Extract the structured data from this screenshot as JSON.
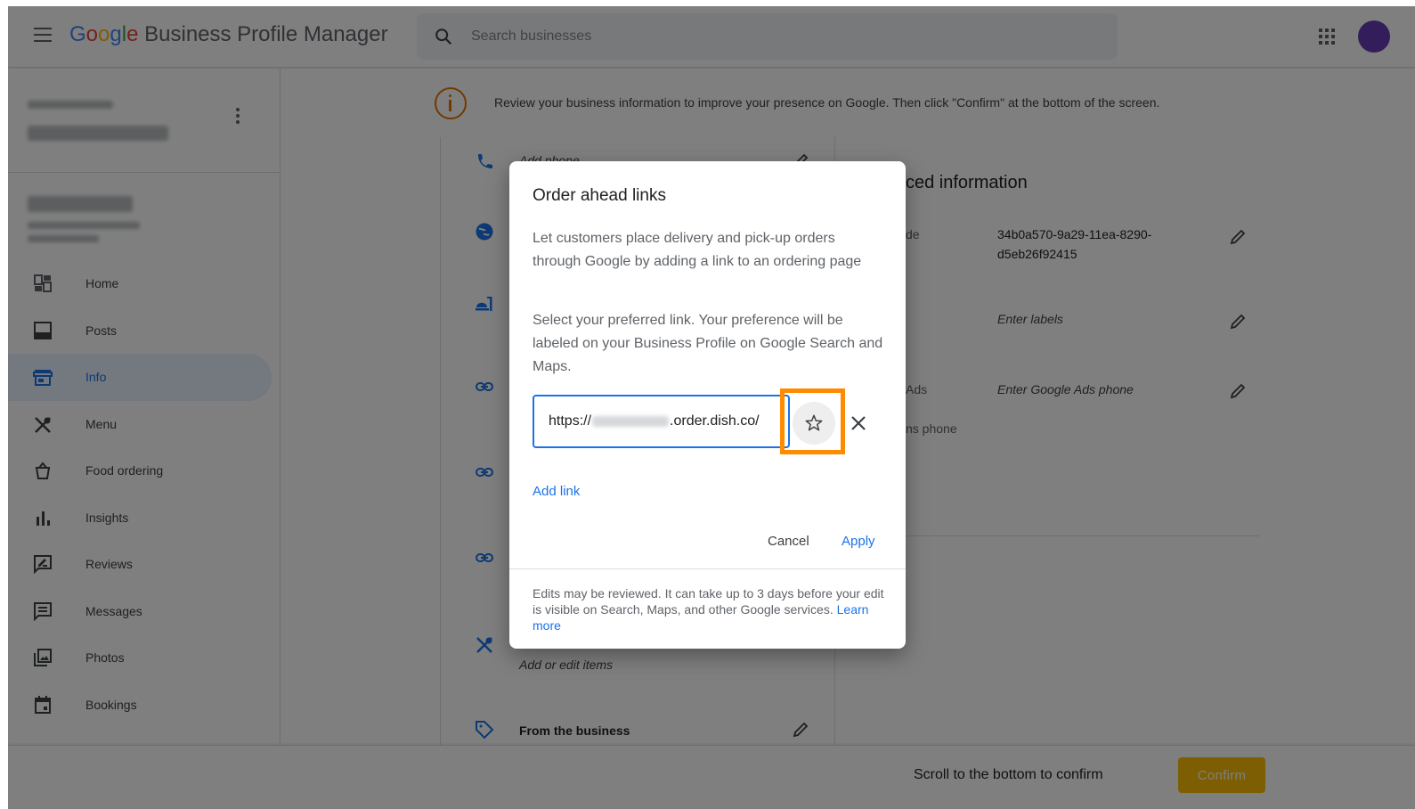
{
  "header": {
    "logo_google": [
      "G",
      "o",
      "o",
      "g",
      "l",
      "e"
    ],
    "logo_rest": "Business Profile Manager",
    "search_placeholder": "Search businesses"
  },
  "sidebar": {
    "items": [
      {
        "label": "Home",
        "icon": "dashboard-icon"
      },
      {
        "label": "Posts",
        "icon": "posts-icon"
      },
      {
        "label": "Info",
        "icon": "storefront-icon"
      },
      {
        "label": "Menu",
        "icon": "restaurant-icon"
      },
      {
        "label": "Food ordering",
        "icon": "takeout-icon"
      },
      {
        "label": "Insights",
        "icon": "bar-chart-icon"
      },
      {
        "label": "Reviews",
        "icon": "reviews-icon"
      },
      {
        "label": "Messages",
        "icon": "messages-icon"
      },
      {
        "label": "Photos",
        "icon": "photos-icon"
      },
      {
        "label": "Bookings",
        "icon": "calendar-icon"
      }
    ],
    "active_index": 2
  },
  "main": {
    "notice": "Review your business information to improve your presence on Google. Then click \"Confirm\" at the bottom of the screen.",
    "rows": {
      "phone": "Add phone",
      "menu": "Add or edit items",
      "from_business": "From the business"
    },
    "advanced": {
      "title_fragment": "ced information",
      "store_code_label": "de",
      "store_code_value": "34b0a570-9a29-11ea-8290-d5eb26f92415",
      "labels_value": "Enter labels",
      "ads_label": "Ads",
      "ads_value": "Enter Google Ads phone",
      "ads_sub": "ns phone"
    }
  },
  "bottom_bar": {
    "text": "Scroll to the bottom to confirm",
    "confirm_label": "Confirm"
  },
  "dialog": {
    "title": "Order ahead links",
    "paragraph1": "Let customers place delivery and pick-up orders through Google by adding a link to an ordering page",
    "paragraph2": "Select your preferred link. Your preference will be labeled on your Business Profile on Google Search and Maps.",
    "url_prefix": "https://",
    "url_suffix": ".order.dish.co/",
    "add_link": "Add link",
    "cancel": "Cancel",
    "apply": "Apply",
    "footer_text": "Edits may be reviewed. It can take up to 3 days before your edit is visible on Search, Maps, and other Google services.",
    "learn_more": "Learn more"
  },
  "colors": {
    "accent": "#1a73e8",
    "highlight": "#ff8c00",
    "confirm": "#fbbc04",
    "notice": "#e37400"
  }
}
